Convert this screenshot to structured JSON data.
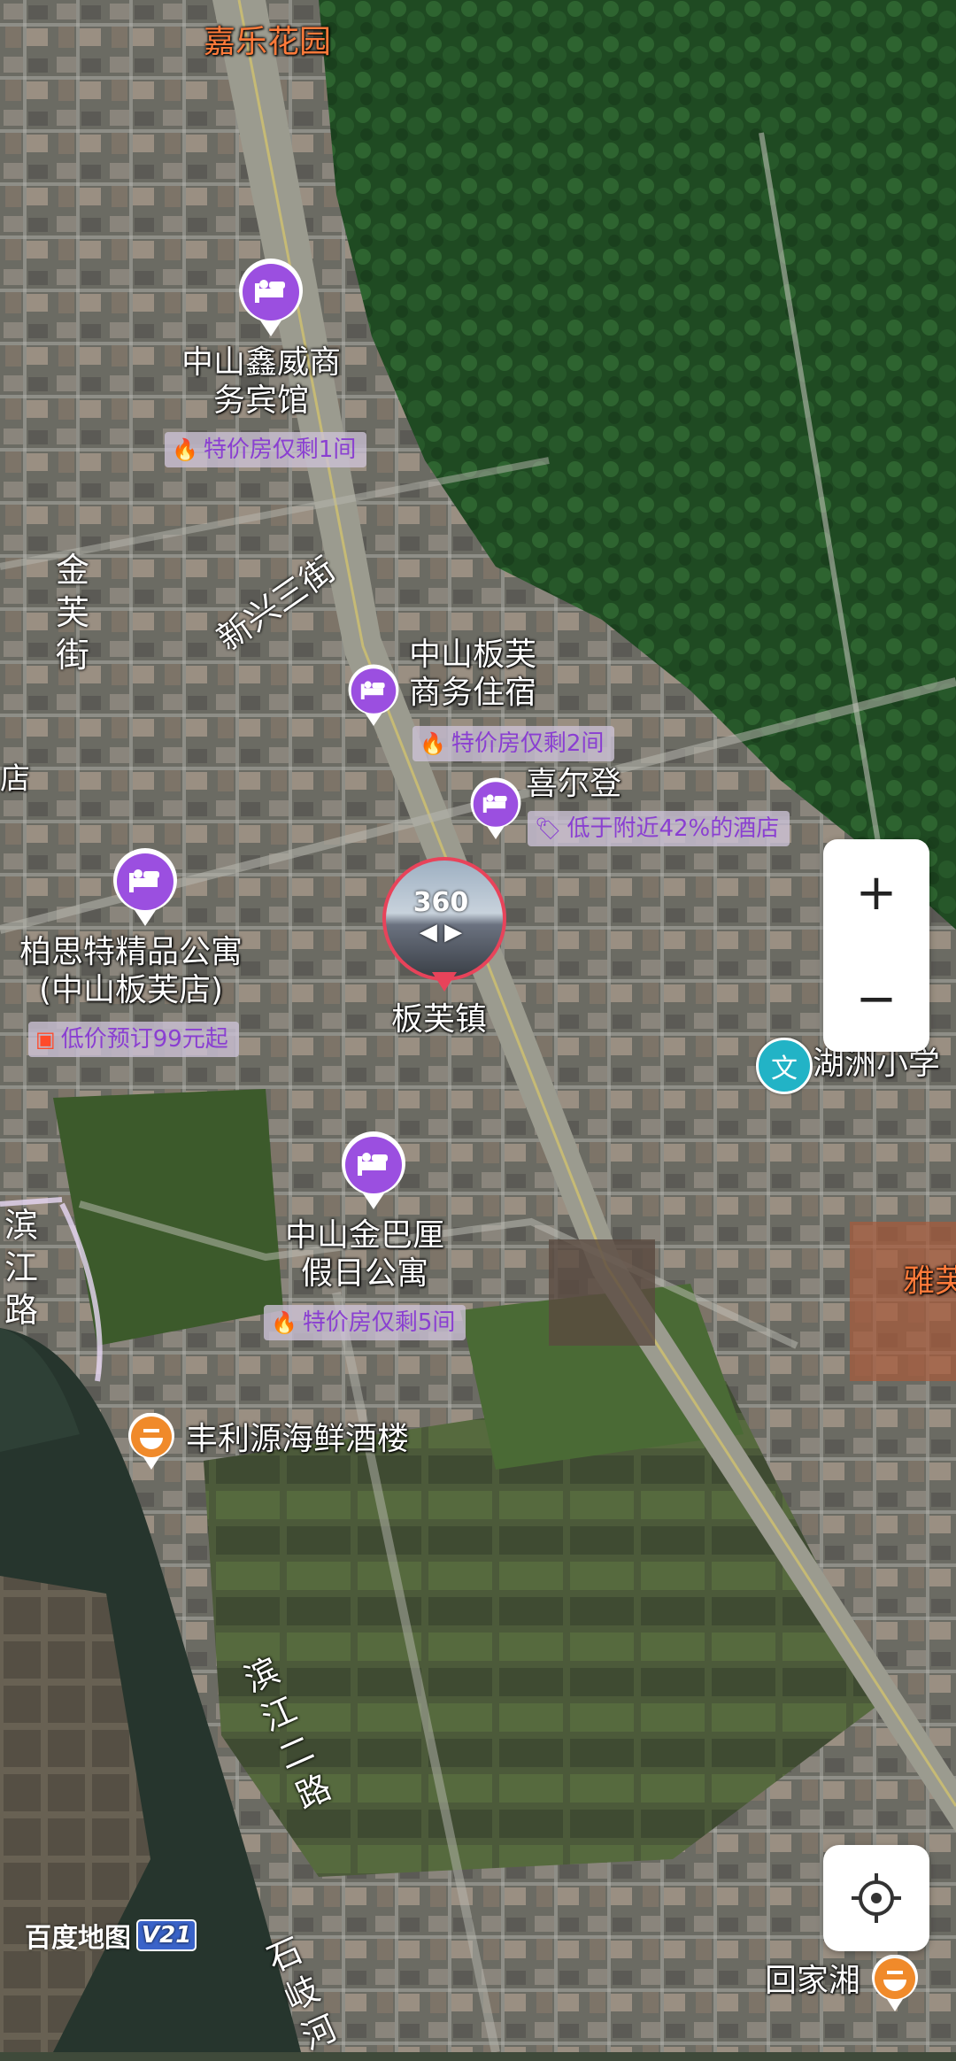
{
  "map": {
    "place_labels": {
      "jiale": "嘉乐花园",
      "yaying": "雅芙",
      "banfu_town": "板芙镇"
    },
    "roads": {
      "jinfu": "金芙街",
      "xinxing": "新兴三街",
      "binjiang_partial": "滨江路",
      "binjiang2": "滨江二路",
      "shiqi": "石岐河",
      "edge_label": "店"
    },
    "hotels": [
      {
        "name_line1": "中山鑫威商",
        "name_line2": "务宾馆",
        "promo": "特价房仅剩1间",
        "promo_icon": "fire-icon"
      },
      {
        "name_line1": "中山板芙",
        "name_line2": "商务住宿",
        "promo": "特价房仅剩2间",
        "promo_icon": "fire-icon"
      },
      {
        "name_line1": "喜尔登",
        "promo": "低于附近42%的酒店",
        "promo_icon": "price-tag-icon"
      },
      {
        "name_line1": "柏思特精品公寓",
        "name_line2": "(中山板芙店)",
        "promo": "低价预订99元起",
        "promo_icon": "coupon-icon"
      },
      {
        "name_line1": "中山金巴厘",
        "name_line2": "假日公寓",
        "promo": "特价房仅剩5间",
        "promo_icon": "fire-icon"
      }
    ],
    "pois": {
      "school": "湖洲小学",
      "school_icon_text": "文",
      "restaurant": "丰利源海鲜酒楼",
      "restaurant2": "回家湘"
    },
    "vr": {
      "label": "360",
      "arrows": "◀ ▶"
    }
  },
  "controls": {
    "zoom_in": "+",
    "zoom_out": "−"
  },
  "logo": {
    "text": "百度地图",
    "version": "V21"
  },
  "colors": {
    "hotel_pin": "#9b4fe0",
    "promo_text": "#8a3fd1",
    "fire": "#ff4a2a",
    "school": "#22b3c6",
    "restaurant": "#f08a2a",
    "vr_ring": "#e8435a"
  }
}
